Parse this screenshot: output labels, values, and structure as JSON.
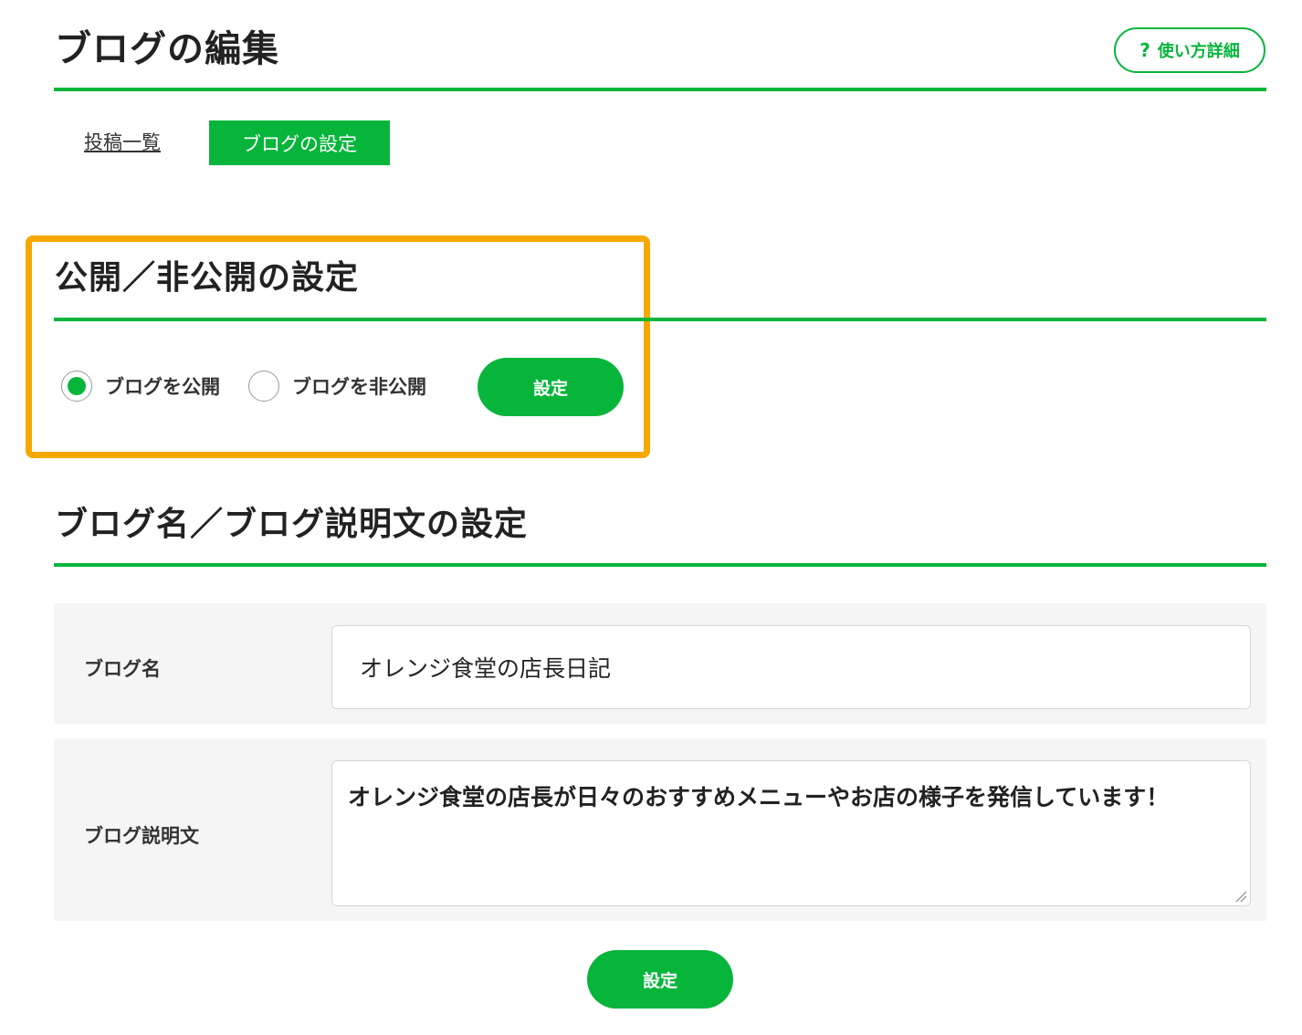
{
  "header": {
    "title": "ブログの編集",
    "help_icon": "?",
    "help_label": "使い方詳細"
  },
  "tabs": {
    "posts_label": "投稿一覧",
    "settings_label": "ブログの設定",
    "active": "settings"
  },
  "visibility_section": {
    "title": "公開／非公開の設定",
    "options": [
      {
        "label": "ブログを公開",
        "selected": true
      },
      {
        "label": "ブログを非公開",
        "selected": false
      }
    ],
    "submit_label": "設定"
  },
  "name_section": {
    "title": "ブログ名／ブログ説明文の設定",
    "blog_name": {
      "label": "ブログ名",
      "value": "オレンジ食堂の店長日記"
    },
    "blog_description": {
      "label": "ブログ説明文",
      "value": "オレンジ食堂の店長が日々のおすすめメニューやお店の様子を発信しています！"
    },
    "submit_label": "設定"
  },
  "colors": {
    "accent": "#07b53b",
    "highlight": "#f5a800",
    "row_background": "#f5f5f5"
  }
}
